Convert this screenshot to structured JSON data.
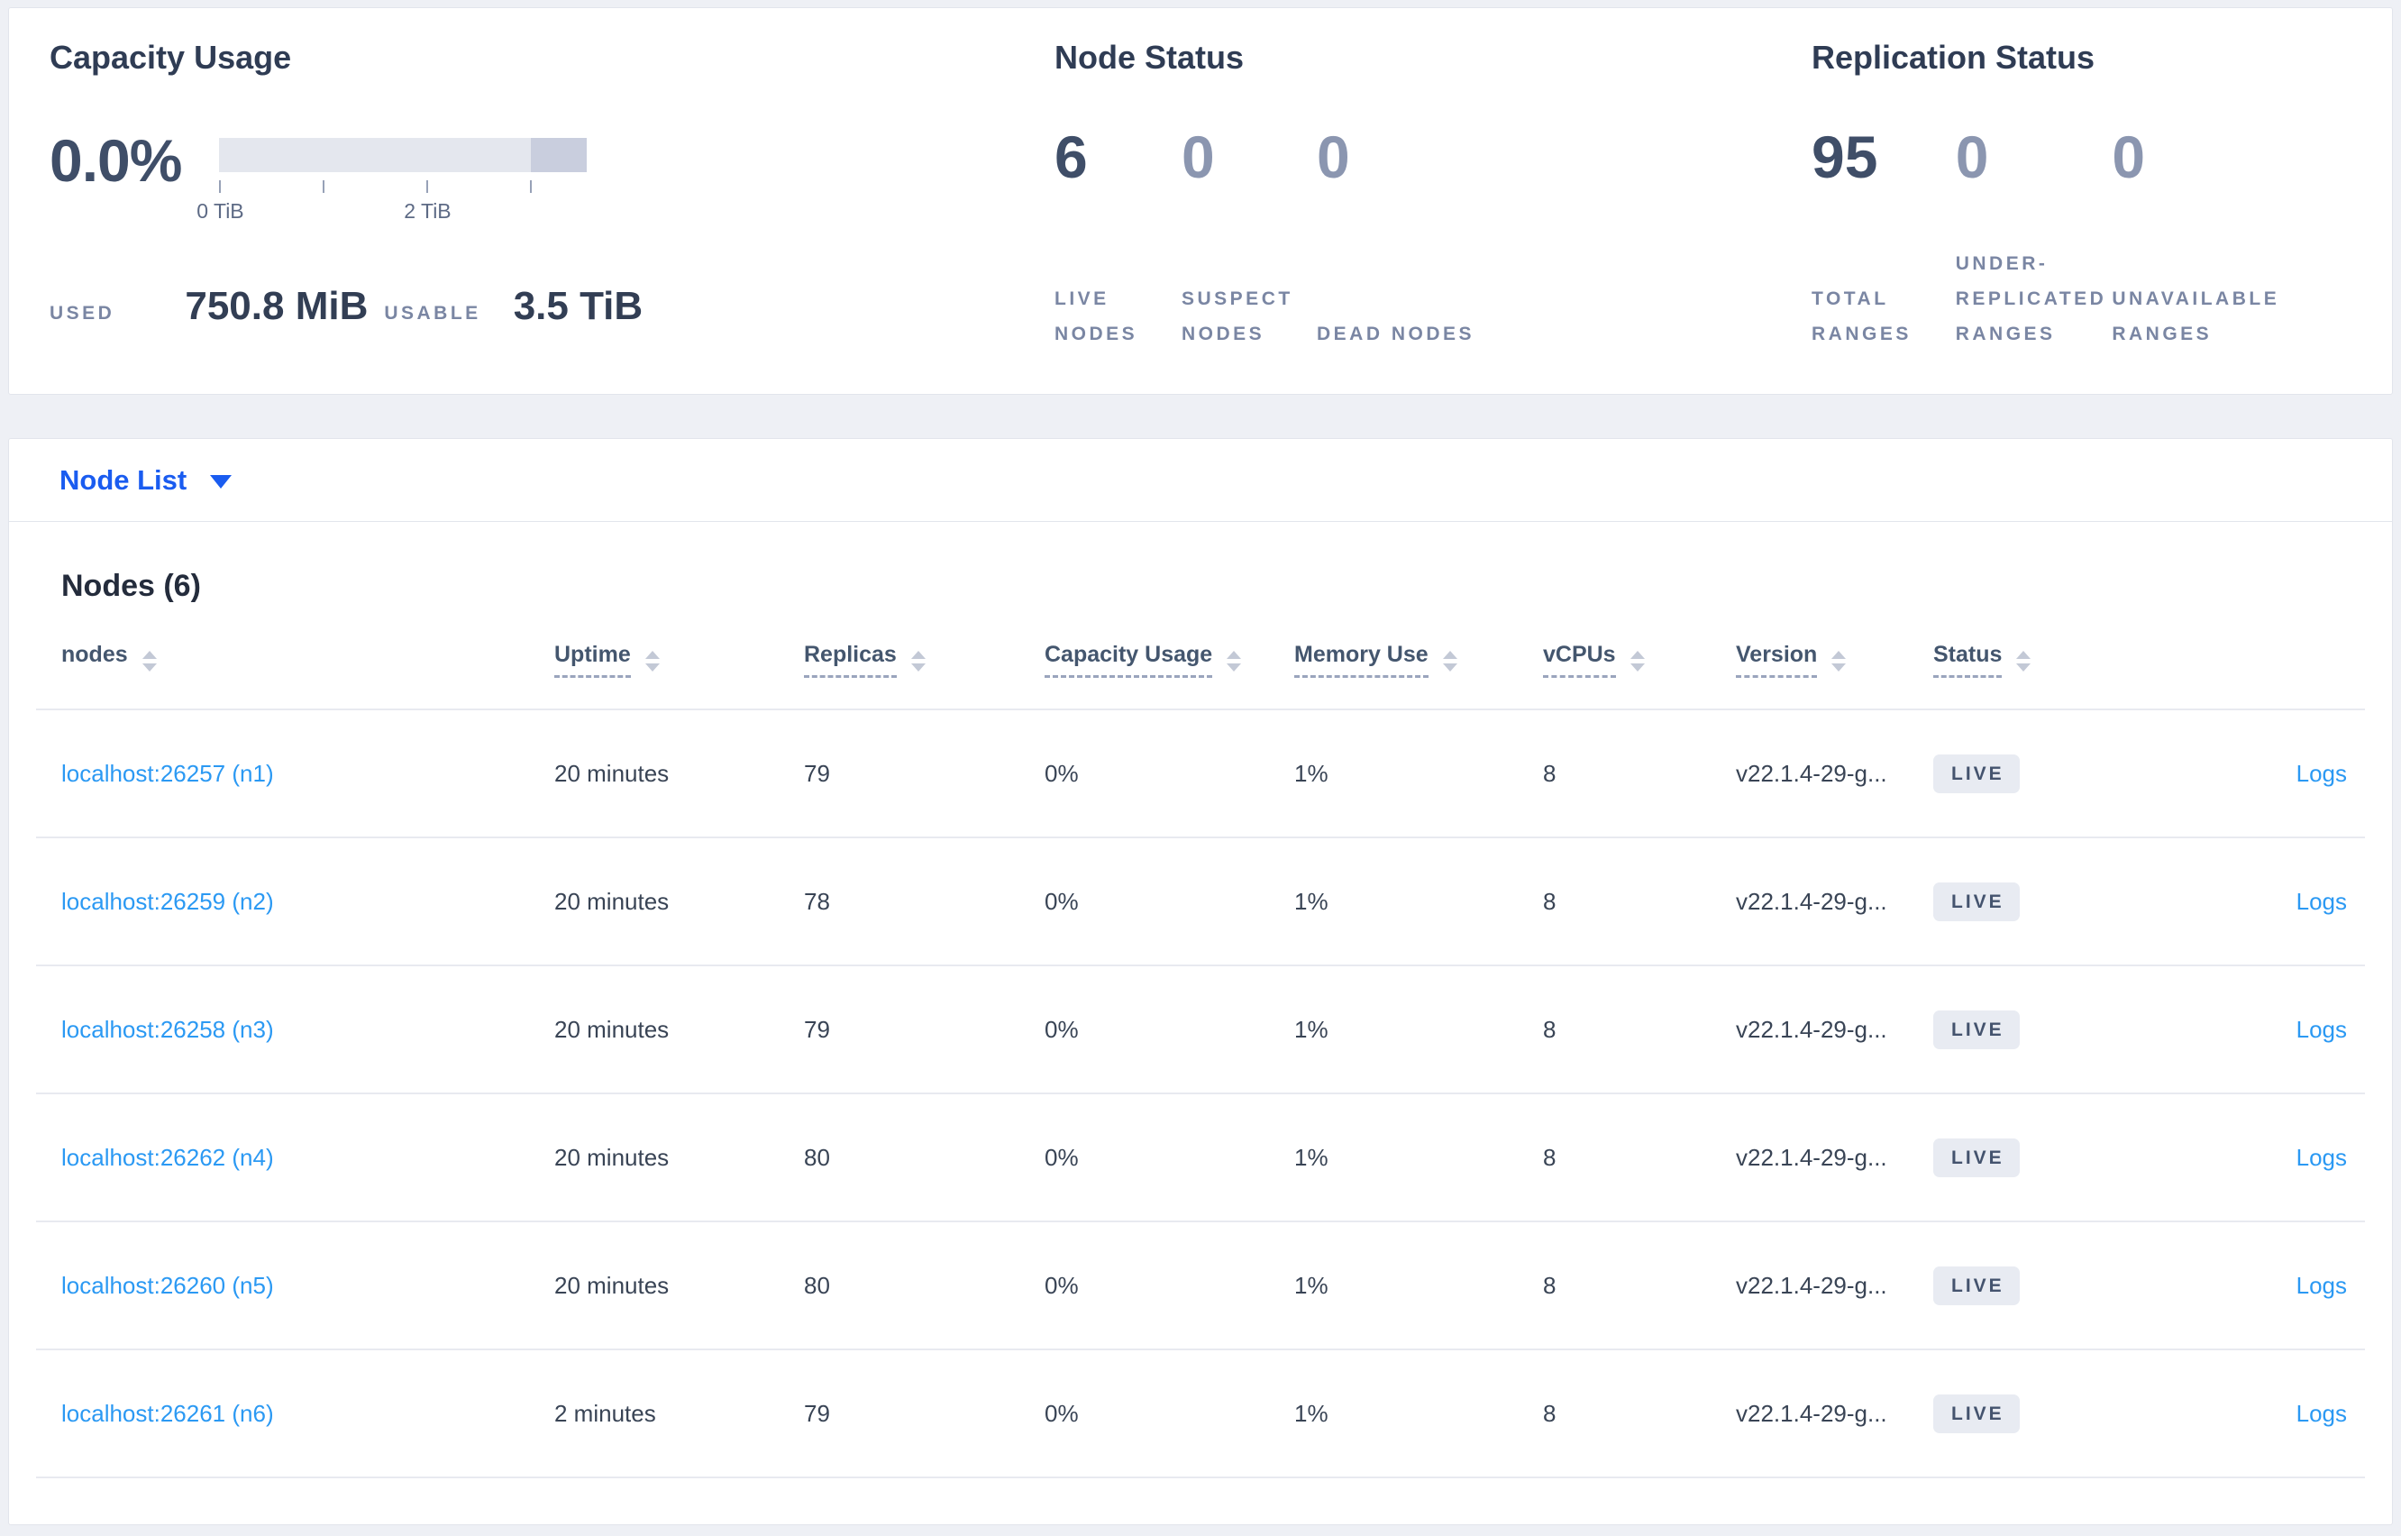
{
  "summary": {
    "capacity": {
      "title": "Capacity Usage",
      "percent": "0.0%",
      "tick_label_0": "0 TiB",
      "tick_label_2": "2 TiB",
      "used_label": "USED",
      "used_value": "750.8 MiB",
      "usable_label": "USABLE",
      "usable_value": "3.5 TiB",
      "bar_light_color": "#e4e7ee",
      "bar_dark_color": "#c9cede"
    },
    "node_status": {
      "title": "Node Status",
      "stats": [
        {
          "value": "6",
          "label": "LIVE NODES"
        },
        {
          "value": "0",
          "label": "SUSPECT NODES"
        },
        {
          "value": "0",
          "label": "DEAD NODES"
        }
      ]
    },
    "replication": {
      "title": "Replication Status",
      "stats": [
        {
          "value": "95",
          "label": "TOTAL RANGES"
        },
        {
          "value": "0",
          "label": "UNDER-REPLICATED RANGES"
        },
        {
          "value": "0",
          "label": "UNAVAILABLE RANGES"
        }
      ]
    }
  },
  "node_list_bar": {
    "label": "Node List"
  },
  "nodes_table": {
    "title": "Nodes (6)",
    "columns": {
      "nodes": "nodes",
      "uptime": "Uptime",
      "replicas": "Replicas",
      "capacity": "Capacity Usage",
      "memory": "Memory Use",
      "vcpus": "vCPUs",
      "version": "Version",
      "status": "Status"
    },
    "rows": [
      {
        "node": "localhost:26257 (n1)",
        "uptime": "20 minutes",
        "replicas": "79",
        "capacity": "0%",
        "memory": "1%",
        "vcpus": "8",
        "version": "v22.1.4-29-g...",
        "status": "LIVE",
        "logs": "Logs"
      },
      {
        "node": "localhost:26259 (n2)",
        "uptime": "20 minutes",
        "replicas": "78",
        "capacity": "0%",
        "memory": "1%",
        "vcpus": "8",
        "version": "v22.1.4-29-g...",
        "status": "LIVE",
        "logs": "Logs"
      },
      {
        "node": "localhost:26258 (n3)",
        "uptime": "20 minutes",
        "replicas": "79",
        "capacity": "0%",
        "memory": "1%",
        "vcpus": "8",
        "version": "v22.1.4-29-g...",
        "status": "LIVE",
        "logs": "Logs"
      },
      {
        "node": "localhost:26262 (n4)",
        "uptime": "20 minutes",
        "replicas": "80",
        "capacity": "0%",
        "memory": "1%",
        "vcpus": "8",
        "version": "v22.1.4-29-g...",
        "status": "LIVE",
        "logs": "Logs"
      },
      {
        "node": "localhost:26260 (n5)",
        "uptime": "20 minutes",
        "replicas": "80",
        "capacity": "0%",
        "memory": "1%",
        "vcpus": "8",
        "version": "v22.1.4-29-g...",
        "status": "LIVE",
        "logs": "Logs"
      },
      {
        "node": "localhost:26261 (n6)",
        "uptime": "2 minutes",
        "replicas": "79",
        "capacity": "0%",
        "memory": "1%",
        "vcpus": "8",
        "version": "v22.1.4-29-g...",
        "status": "LIVE",
        "logs": "Logs"
      }
    ]
  },
  "colors": {
    "link_blue": "#2b99f3",
    "dropdown_blue": "#1a5cf0",
    "badge_bg": "#e8ebf2",
    "dark_stat": "#3f4e68",
    "muted_stat": "#8b96b0"
  }
}
